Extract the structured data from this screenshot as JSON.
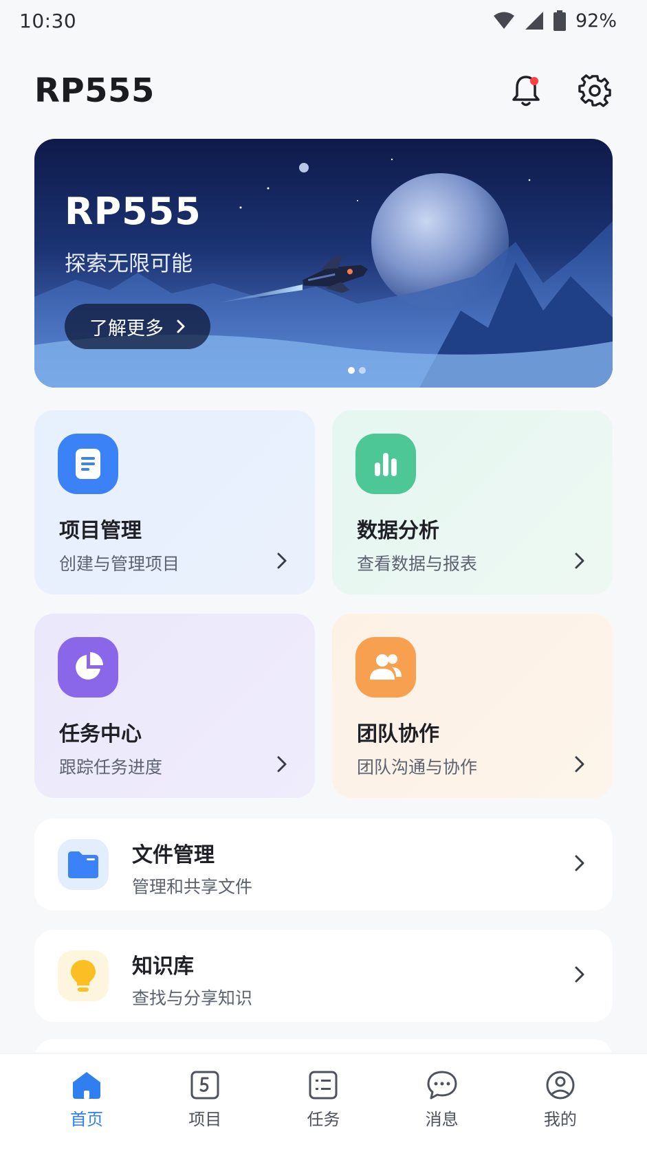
{
  "status_bar": {
    "time": "10:30",
    "battery": "92%",
    "icons": [
      "wifi-icon",
      "cellular-signal-icon",
      "battery-icon"
    ]
  },
  "header": {
    "title": "RP555",
    "icons": [
      "bell-icon",
      "gear-icon"
    ],
    "notification_dot_color": "#ff4141"
  },
  "banner": {
    "title": "RP555",
    "subtitle": "探索无限可能",
    "button_label": "了解更多",
    "page_count": 2,
    "active_page": 1
  },
  "feature_cards": [
    {
      "title": "项目管理",
      "subtitle": "创建与管理项目",
      "icon": "document-icon",
      "color": "#3b82f6"
    },
    {
      "title": "数据分析",
      "subtitle": "查看数据与报表",
      "icon": "bar-chart-icon",
      "color": "#4cc795"
    },
    {
      "title": "任务中心",
      "subtitle": "跟踪任务进度",
      "icon": "pie-chart-icon",
      "color": "#8a66e8"
    },
    {
      "title": "团队协作",
      "subtitle": "团队沟通与协作",
      "icon": "team-icon",
      "color": "#f7a04f"
    }
  ],
  "list_items": [
    {
      "title": "文件管理",
      "subtitle": "管理和共享文件",
      "icon": "folder-icon",
      "color": "#3b82f6"
    },
    {
      "title": "知识库",
      "subtitle": "查找与分享知识",
      "icon": "lightbulb-icon",
      "color": "#fbbf24"
    }
  ],
  "tab_bar": [
    {
      "label": "首页",
      "icon": "home-icon",
      "active": true
    },
    {
      "label": "项目",
      "icon": "project-icon",
      "active": false
    },
    {
      "label": "任务",
      "icon": "task-list-icon",
      "active": false
    },
    {
      "label": "消息",
      "icon": "message-icon",
      "active": false
    },
    {
      "label": "我的",
      "icon": "profile-icon",
      "active": false
    }
  ],
  "colors": {
    "accent": "#2f7ff0",
    "background": "#f7f8fa"
  }
}
